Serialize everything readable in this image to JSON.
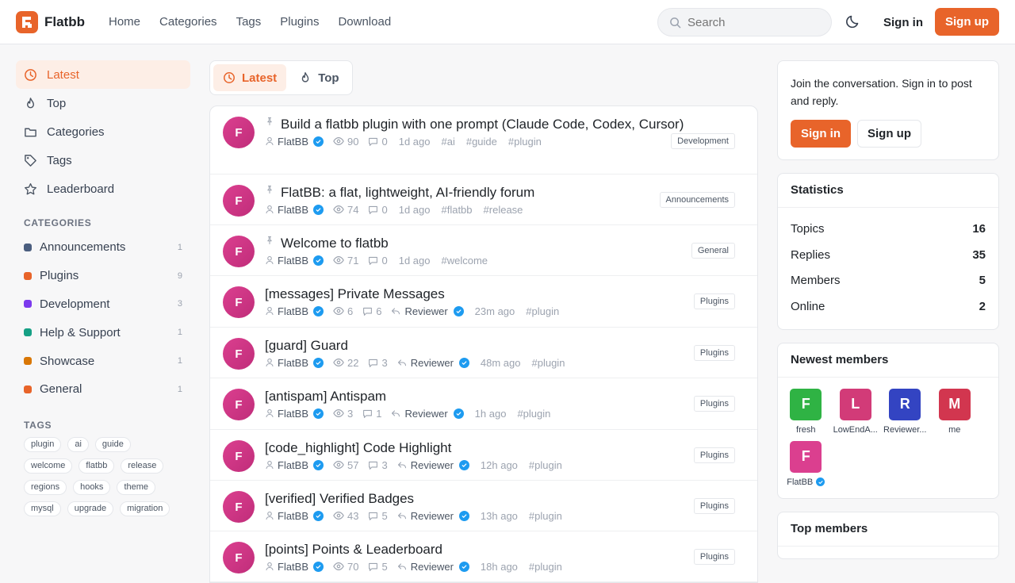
{
  "brand": {
    "name": "Flatbb",
    "color": "#e8642a"
  },
  "nav": [
    "Home",
    "Categories",
    "Tags",
    "Plugins",
    "Download"
  ],
  "search": {
    "placeholder": "Search"
  },
  "auth": {
    "sign_in": "Sign in",
    "sign_up": "Sign up"
  },
  "sidebar": {
    "items": [
      {
        "label": "Latest",
        "icon": "clock-icon",
        "active": true
      },
      {
        "label": "Top",
        "icon": "flame-icon"
      },
      {
        "label": "Categories",
        "icon": "folder-icon"
      },
      {
        "label": "Tags",
        "icon": "tag-icon"
      },
      {
        "label": "Leaderboard",
        "icon": "star-icon"
      }
    ],
    "categories_heading": "CATEGORIES",
    "categories": [
      {
        "name": "Announcements",
        "count": "1",
        "color": "#4b5e7f"
      },
      {
        "name": "Plugins",
        "count": "9",
        "color": "#e8642a"
      },
      {
        "name": "Development",
        "count": "3",
        "color": "#7c3aed"
      },
      {
        "name": "Help & Support",
        "count": "1",
        "color": "#16a085"
      },
      {
        "name": "Showcase",
        "count": "1",
        "color": "#d97706"
      },
      {
        "name": "General",
        "count": "1",
        "color": "#e8642a"
      }
    ],
    "tags_heading": "TAGS",
    "tags": [
      "plugin",
      "ai",
      "guide",
      "welcome",
      "flatbb",
      "release",
      "regions",
      "hooks",
      "theme",
      "mysql",
      "upgrade",
      "migration"
    ]
  },
  "main": {
    "tabs": [
      {
        "label": "Latest",
        "icon": "clock-icon",
        "active": true
      },
      {
        "label": "Top",
        "icon": "flame-icon"
      }
    ],
    "topics": [
      {
        "avatar": "F",
        "pinned": true,
        "title": "Build a flatbb plugin with one prompt (Claude Code, Codex, Cursor)",
        "author": "FlatBB",
        "views": "90",
        "replies": "0",
        "last_reply_by": "",
        "time": "1d ago",
        "tags": [
          "#ai",
          "#guide",
          "#plugin"
        ],
        "category": "Development"
      },
      {
        "avatar": "F",
        "pinned": true,
        "title": "FlatBB: a flat, lightweight, AI-friendly forum",
        "author": "FlatBB",
        "views": "74",
        "replies": "0",
        "last_reply_by": "",
        "time": "1d ago",
        "tags": [
          "#flatbb",
          "#release"
        ],
        "category": "Announcements"
      },
      {
        "avatar": "F",
        "pinned": true,
        "title": "Welcome to flatbb",
        "author": "FlatBB",
        "views": "71",
        "replies": "0",
        "last_reply_by": "",
        "time": "1d ago",
        "tags": [
          "#welcome"
        ],
        "category": "General"
      },
      {
        "avatar": "F",
        "pinned": false,
        "title": "[messages] Private Messages",
        "author": "FlatBB",
        "views": "6",
        "replies": "6",
        "last_reply_by": "Reviewer",
        "time": "23m ago",
        "tags": [
          "#plugin"
        ],
        "category": "Plugins"
      },
      {
        "avatar": "F",
        "pinned": false,
        "title": "[guard] Guard",
        "author": "FlatBB",
        "views": "22",
        "replies": "3",
        "last_reply_by": "Reviewer",
        "time": "48m ago",
        "tags": [
          "#plugin"
        ],
        "category": "Plugins"
      },
      {
        "avatar": "F",
        "pinned": false,
        "title": "[antispam] Antispam",
        "author": "FlatBB",
        "views": "3",
        "replies": "1",
        "last_reply_by": "Reviewer",
        "time": "1h ago",
        "tags": [
          "#plugin"
        ],
        "category": "Plugins"
      },
      {
        "avatar": "F",
        "pinned": false,
        "title": "[code_highlight] Code Highlight",
        "author": "FlatBB",
        "views": "57",
        "replies": "3",
        "last_reply_by": "Reviewer",
        "time": "12h ago",
        "tags": [
          "#plugin"
        ],
        "category": "Plugins"
      },
      {
        "avatar": "F",
        "pinned": false,
        "title": "[verified] Verified Badges",
        "author": "FlatBB",
        "views": "43",
        "replies": "5",
        "last_reply_by": "Reviewer",
        "time": "13h ago",
        "tags": [
          "#plugin"
        ],
        "category": "Plugins"
      },
      {
        "avatar": "F",
        "pinned": false,
        "title": "[points] Points & Leaderboard",
        "author": "FlatBB",
        "views": "70",
        "replies": "5",
        "last_reply_by": "Reviewer",
        "time": "18h ago",
        "tags": [
          "#plugin"
        ],
        "category": "Plugins"
      }
    ]
  },
  "right": {
    "join_text": "Join the conversation. Sign in to post and reply.",
    "sign_in": "Sign in",
    "sign_up": "Sign up",
    "stats_title": "Statistics",
    "stats": [
      {
        "label": "Topics",
        "value": "16"
      },
      {
        "label": "Replies",
        "value": "35"
      },
      {
        "label": "Members",
        "value": "5"
      },
      {
        "label": "Online",
        "value": "2"
      }
    ],
    "newest_title": "Newest members",
    "members": [
      {
        "initial": "F",
        "name": "fresh",
        "color": "#2fb344",
        "verified": false
      },
      {
        "initial": "L",
        "name": "LowEndA...",
        "color": "#d23b78",
        "verified": false
      },
      {
        "initial": "R",
        "name": "Reviewer...",
        "color": "#3344c2",
        "verified": false
      },
      {
        "initial": "M",
        "name": "me",
        "color": "#d2364f",
        "verified": false
      },
      {
        "initial": "F",
        "name": "FlatBB",
        "color": "#db3f8f",
        "verified": true
      }
    ],
    "top_title": "Top members"
  }
}
